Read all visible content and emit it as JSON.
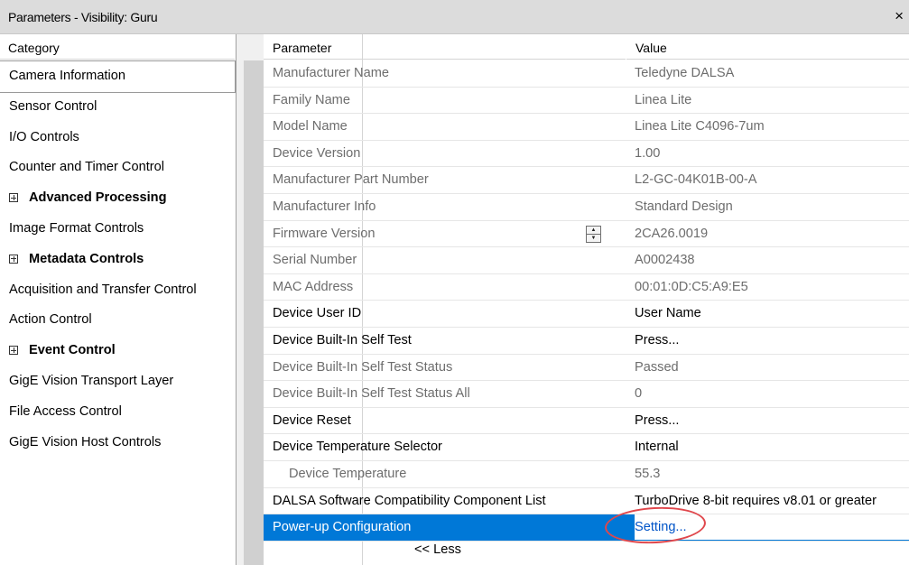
{
  "window": {
    "title": "Parameters - Visibility: Guru",
    "close_glyph": "×"
  },
  "category_header": "Category",
  "parameter_header": "Parameter",
  "value_header": "Value",
  "categories": [
    {
      "label": "Camera Information",
      "selected": true,
      "group": false
    },
    {
      "label": "Sensor Control",
      "group": false
    },
    {
      "label": "I/O Controls",
      "group": false
    },
    {
      "label": "Counter and Timer Control",
      "group": false
    },
    {
      "label": "Advanced Processing",
      "group": true
    },
    {
      "label": "Image Format Controls",
      "group": false
    },
    {
      "label": "Metadata Controls",
      "group": true
    },
    {
      "label": "Acquisition and Transfer Control",
      "group": false
    },
    {
      "label": "Action Control",
      "group": false
    },
    {
      "label": "Event Control",
      "group": true
    },
    {
      "label": "GigE Vision Transport Layer",
      "group": false
    },
    {
      "label": "File Access Control",
      "group": false
    },
    {
      "label": "GigE Vision Host Controls",
      "group": false
    }
  ],
  "rows": [
    {
      "param": "Manufacturer Name",
      "value": "Teledyne DALSA",
      "readonly": true
    },
    {
      "param": "Family Name",
      "value": "Linea Lite",
      "readonly": true
    },
    {
      "param": "Model Name",
      "value": "Linea Lite C4096-7um",
      "readonly": true
    },
    {
      "param": "Device Version",
      "value": "1.00",
      "readonly": true
    },
    {
      "param": "Manufacturer Part Number",
      "value": "L2-GC-04K01B-00-A",
      "readonly": true
    },
    {
      "param": "Manufacturer Info",
      "value": "Standard Design",
      "readonly": true
    },
    {
      "param": "Firmware Version",
      "value": "2CA26.0019",
      "readonly": true,
      "spinner": true
    },
    {
      "param": "Serial Number",
      "value": "A0002438",
      "readonly": true
    },
    {
      "param": "MAC Address",
      "value": "00:01:0D:C5:A9:E5",
      "readonly": true
    },
    {
      "param": "Device User ID",
      "value": "User Name",
      "readonly": false
    },
    {
      "param": "Device Built-In Self Test",
      "value": "Press...",
      "readonly": false
    },
    {
      "param": "Device Built-In Self Test Status",
      "value": "Passed",
      "readonly": true
    },
    {
      "param": "Device Built-In Self Test Status All",
      "value": "0",
      "readonly": true
    },
    {
      "param": "Device Reset",
      "value": "Press...",
      "readonly": false
    },
    {
      "param": "Device Temperature Selector",
      "value": "Internal",
      "readonly": false
    },
    {
      "param": "Device Temperature",
      "value": "55.3",
      "readonly": true,
      "indent": true
    },
    {
      "param": "DALSA Software Compatibility Component List",
      "value": "TurboDrive 8-bit requires v8.01 or greater",
      "readonly": false
    },
    {
      "param": "Power-up Configuration",
      "value": "Setting...",
      "readonly": false,
      "selected": true
    }
  ],
  "less_button": "<< Less",
  "accent_color": "#0078d7",
  "highlight_color": "#e0474c"
}
